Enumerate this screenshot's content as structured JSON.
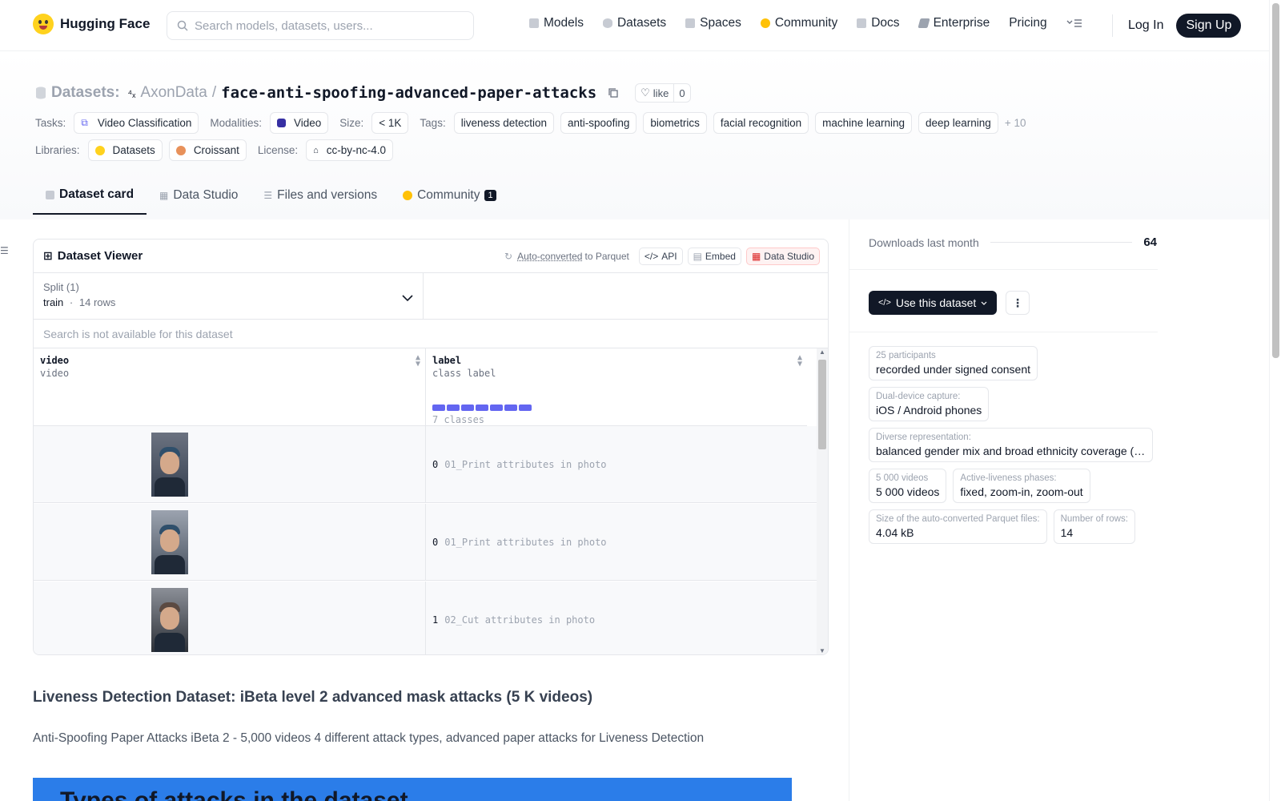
{
  "nav": {
    "brand": "Hugging Face",
    "search_placeholder": "Search models, datasets, users...",
    "links": [
      "Models",
      "Datasets",
      "Spaces",
      "Community",
      "Docs",
      "Enterprise",
      "Pricing"
    ],
    "login": "Log In",
    "signup": "Sign Up"
  },
  "header": {
    "section": "Datasets:",
    "org": "AxonData",
    "sep": "/",
    "name": "face-anti-spoofing-advanced-paper-attacks",
    "like_label": "like",
    "like_count": "0",
    "tasks_label": "Tasks:",
    "task": "Video Classification",
    "modalities_label": "Modalities:",
    "modality": "Video",
    "size_label": "Size:",
    "size": "< 1K",
    "tags_label": "Tags:",
    "tags": [
      "liveness detection",
      "anti-spoofing",
      "biometrics",
      "facial recognition",
      "machine learning",
      "deep learning"
    ],
    "tags_more": "+ 10",
    "libraries_label": "Libraries:",
    "libraries": [
      "Datasets",
      "Croissant"
    ],
    "license_label": "License:",
    "license": "cc-by-nc-4.0"
  },
  "tabs": {
    "dataset_card": "Dataset card",
    "data_studio": "Data Studio",
    "files": "Files and versions",
    "community": "Community",
    "community_count": "1"
  },
  "viewer": {
    "title": "Dataset Viewer",
    "auto_converted": "Auto-converted",
    "to_parquet": "to Parquet",
    "api": "API",
    "embed": "Embed",
    "data_studio": "Data Studio",
    "split_label": "Split (1)",
    "split_name": "train",
    "split_dot": "·",
    "split_rows": "14 rows",
    "search_placeholder": "Search is not available for this dataset",
    "columns": [
      {
        "name": "video",
        "type": "video"
      },
      {
        "name": "label",
        "type": "class label",
        "classes": "7 classes"
      }
    ],
    "rows": [
      {
        "num": "0",
        "label": "01_Print attributes in photo"
      },
      {
        "num": "0",
        "label": "01_Print attributes in photo"
      },
      {
        "num": "1",
        "label": "02_Cut attributes in photo"
      }
    ],
    "class_bar_color": "#6366f1"
  },
  "sidebar": {
    "downloads_label": "Downloads last month",
    "downloads_value": "64",
    "use_button": "Use this dataset",
    "facts": [
      {
        "k": "25 participants",
        "v": "recorded under signed consent"
      },
      {
        "k": "Dual-device capture:",
        "v": "iOS / Android phones"
      },
      {
        "k": "Diverse representation:",
        "v": "balanced gender mix and broad ethnicity coverage (C..."
      },
      {
        "k": "5 000 videos",
        "v": "5 000 videos"
      },
      {
        "k": "Active-liveness phases:",
        "v": "fixed, zoom-in, zoom-out"
      },
      {
        "k": "Size of the auto-converted Parquet files:",
        "v": "4.04 kB"
      },
      {
        "k": "Number of rows:",
        "v": "14"
      }
    ]
  },
  "content": {
    "heading": "Liveness Detection Dataset: iBeta level 2 advanced mask attacks (5 K videos)",
    "paragraph": "Anti-Spoofing Paper Attacks iBeta 2 - 5,000 videos 4 different attack types, advanced paper attacks for Liveness Detection",
    "banner_text": "Types of attacks in the dataset"
  }
}
